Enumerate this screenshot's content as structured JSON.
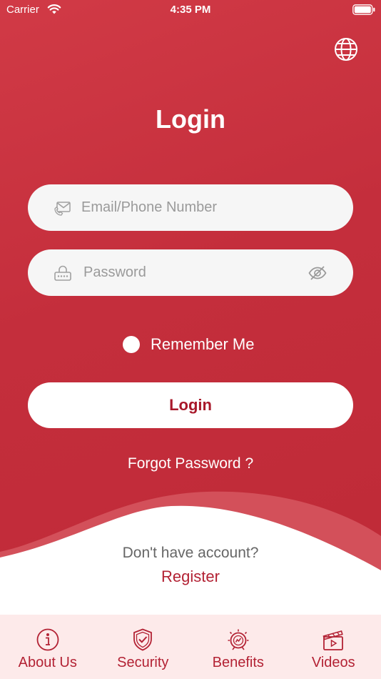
{
  "status_bar": {
    "carrier": "Carrier",
    "time": "4:35 PM"
  },
  "header": {
    "language_icon": "globe-icon",
    "title": "Login"
  },
  "form": {
    "email": {
      "placeholder": "Email/Phone Number",
      "value": "",
      "icon": "mail-phone-icon"
    },
    "password": {
      "placeholder": "Password",
      "value": "",
      "icon": "lock-icon",
      "toggle_icon": "eye-slash-icon"
    },
    "remember_me": {
      "label": "Remember Me",
      "checked": false
    },
    "login_button": "Login",
    "forgot_password": "Forgot Password ?"
  },
  "signup": {
    "prompt": "Don't have account?",
    "register_link": "Register"
  },
  "tabbar": {
    "items": [
      {
        "label": "About Us",
        "icon": "info-icon"
      },
      {
        "label": "Security",
        "icon": "shield-check-icon"
      },
      {
        "label": "Benefits",
        "icon": "benefits-icon"
      },
      {
        "label": "Videos",
        "icon": "clapperboard-icon"
      }
    ]
  },
  "colors": {
    "primary": "#c42e3c",
    "accent_text": "#b32234",
    "field_bg": "#f6f6f6",
    "tabbar_bg": "#fdeaea"
  }
}
